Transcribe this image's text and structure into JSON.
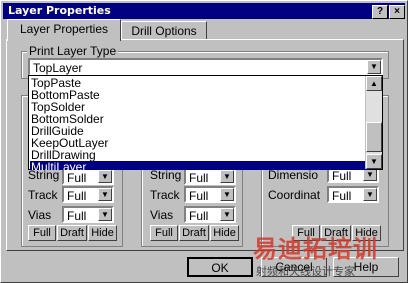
{
  "window": {
    "title": "Layer Properties",
    "help_button": "?",
    "close_button": "×"
  },
  "tabs": [
    {
      "label": "Layer Properties",
      "active": true
    },
    {
      "label": "Drill Options",
      "active": false
    }
  ],
  "print_layer_type": {
    "label": "Print Layer Type",
    "selected": "TopLayer",
    "options": [
      "TopPaste",
      "BottomPaste",
      "TopSolder",
      "BottomSolder",
      "DrillGuide",
      "KeepOutLayer",
      "DrillDrawing",
      "MultiLayer"
    ],
    "highlighted": "MultiLayer"
  },
  "col1": {
    "string_label": "String",
    "string_value": "Full",
    "track_label": "Track",
    "track_value": "Full",
    "vias_label": "Vias",
    "vias_value": "Full",
    "btn_full": "Full",
    "btn_draft": "Draft",
    "btn_hide": "Hide"
  },
  "col2": {
    "string_label": "String",
    "string_value": "Full",
    "track_label": "Track",
    "track_value": "Full",
    "vias_label": "Vias",
    "vias_value": "Full",
    "btn_full": "Full",
    "btn_draft": "Draft",
    "btn_hide": "Hide"
  },
  "col3": {
    "dimension_label": "Dimensio",
    "dimension_value": "Full",
    "coordinate_label": "Coordinat",
    "coordinate_value": "Full",
    "btn_full": "Full",
    "btn_draft": "Draft",
    "btn_hide": "Hide"
  },
  "footer": {
    "ok": "OK",
    "cancel": "Cancel",
    "help": "Help"
  },
  "watermark": {
    "line1": "易迪拓培训",
    "line2": "射频和天线设计专家"
  }
}
